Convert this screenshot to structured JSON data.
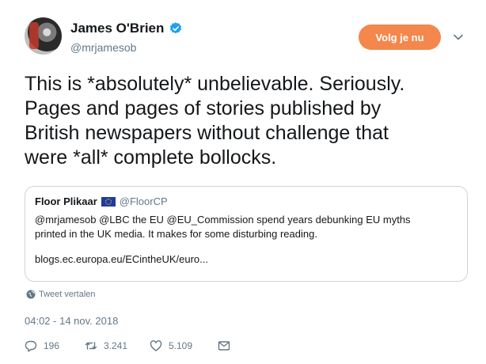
{
  "author": {
    "name": "James O'Brien",
    "handle": "@mrjamesob"
  },
  "follow_label": "Volg je nu",
  "tweet_text": "This is *absolutely* unbelievable. Seriously.\nPages and pages of stories published by\nBritish newspapers without challenge that\nwere *all* complete bollocks.",
  "quote": {
    "name": "Floor Plikaar",
    "handle": "@FloorCP",
    "text_line1": "@mrjamesob @LBC the EU @EU_Commission spend years debunking EU myths",
    "text_line2": "printed in the UK media. It makes for some disturbing reading.",
    "link": "blogs.ec.europa.eu/ECintheUK/euro..."
  },
  "translate_label": "Tweet vertalen",
  "timestamp": "04:02 - 14 nov. 2018",
  "stats": {
    "replies": "196",
    "retweets": "3.241",
    "likes": "5.109"
  },
  "colors": {
    "follow_button": "#f4874b",
    "verified": "#1da1f2",
    "muted_text": "#657786"
  }
}
